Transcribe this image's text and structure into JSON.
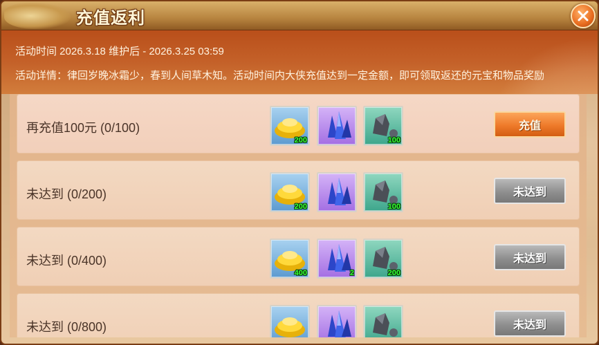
{
  "window": {
    "title": "充值返利"
  },
  "event": {
    "time_text": "活动时间 2026.3.18 维护后 - 2026.3.25 03:59",
    "detail_text": "活动详情：律回岁晚冰霜少，春到人间草木知。活动时间内大侠充值达到一定金额，即可领取返还的元宝和物品奖励"
  },
  "tiers": [
    {
      "label": "再充值100元 (0/100)",
      "button": "充值",
      "button_state": "active",
      "rewards": [
        {
          "icon": "gold-ingot-icon",
          "qty": "200"
        },
        {
          "icon": "blue-crystal-icon",
          "qty": ""
        },
        {
          "icon": "gray-stone-icon",
          "qty": "100"
        }
      ]
    },
    {
      "label": "未达到 (0/200)",
      "button": "未达到",
      "button_state": "disabled",
      "rewards": [
        {
          "icon": "gold-ingot-icon",
          "qty": "200"
        },
        {
          "icon": "blue-crystal-icon",
          "qty": ""
        },
        {
          "icon": "gray-stone-icon",
          "qty": "100"
        }
      ]
    },
    {
      "label": "未达到 (0/400)",
      "button": "未达到",
      "button_state": "disabled",
      "rewards": [
        {
          "icon": "gold-ingot-icon",
          "qty": "400"
        },
        {
          "icon": "blue-crystal-icon",
          "qty": "2"
        },
        {
          "icon": "gray-stone-icon",
          "qty": "200"
        }
      ]
    },
    {
      "label": "未达到 (0/800)",
      "button": "未达到",
      "button_state": "disabled",
      "rewards": [
        {
          "icon": "gold-ingot-icon",
          "qty": ""
        },
        {
          "icon": "blue-crystal-icon",
          "qty": ""
        },
        {
          "icon": "gray-stone-icon",
          "qty": ""
        }
      ]
    }
  ],
  "colors": {
    "accent_button": "#ee7a2a",
    "disabled_button": "#8f8f8f",
    "qty_text": "#35ff35"
  }
}
